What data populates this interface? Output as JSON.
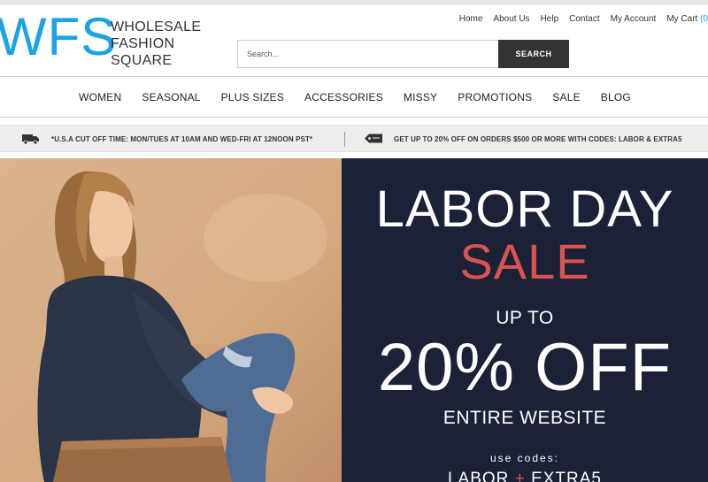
{
  "brand": {
    "mark": "WFS",
    "line1": "WHOLESALE",
    "line2": "FASHION",
    "line3": "SQUARE",
    "color": "#1aa3e6"
  },
  "toplinks": {
    "home": "Home",
    "about": "About Us",
    "help": "Help",
    "contact": "Contact",
    "account": "My Account",
    "cart": "My Cart",
    "cart_count": "(0"
  },
  "search": {
    "placeholder": "Search...",
    "button": "SEARCH"
  },
  "nav": {
    "items": [
      "WOMEN",
      "SEASONAL",
      "PLUS SIZES",
      "ACCESSORIES",
      "MISSY",
      "PROMOTIONS",
      "SALE",
      "BLOG"
    ]
  },
  "promo": {
    "left_icon": "truck-icon",
    "left_text": "*U.S.A CUT OFF TIME: MON/TUES AT 10AM AND WED-FRI AT 12NOON PST*",
    "right_icon": "price-tag-icon",
    "right_text": "GET UP TO 20% OFF ON ORDERS $500 OR MORE WITH CODES: LABOR & EXTRA5"
  },
  "hero": {
    "title": "LABOR DAY",
    "sale": "SALE",
    "upto": "UP TO",
    "discount": "20% OFF",
    "scope": "ENTIRE WEBSITE",
    "use_codes": "use codes:",
    "code1": "LABOR",
    "plus": "+",
    "code2": "EXTRA5",
    "panel_color": "#1b2136",
    "accent_color": "#d9534f"
  }
}
